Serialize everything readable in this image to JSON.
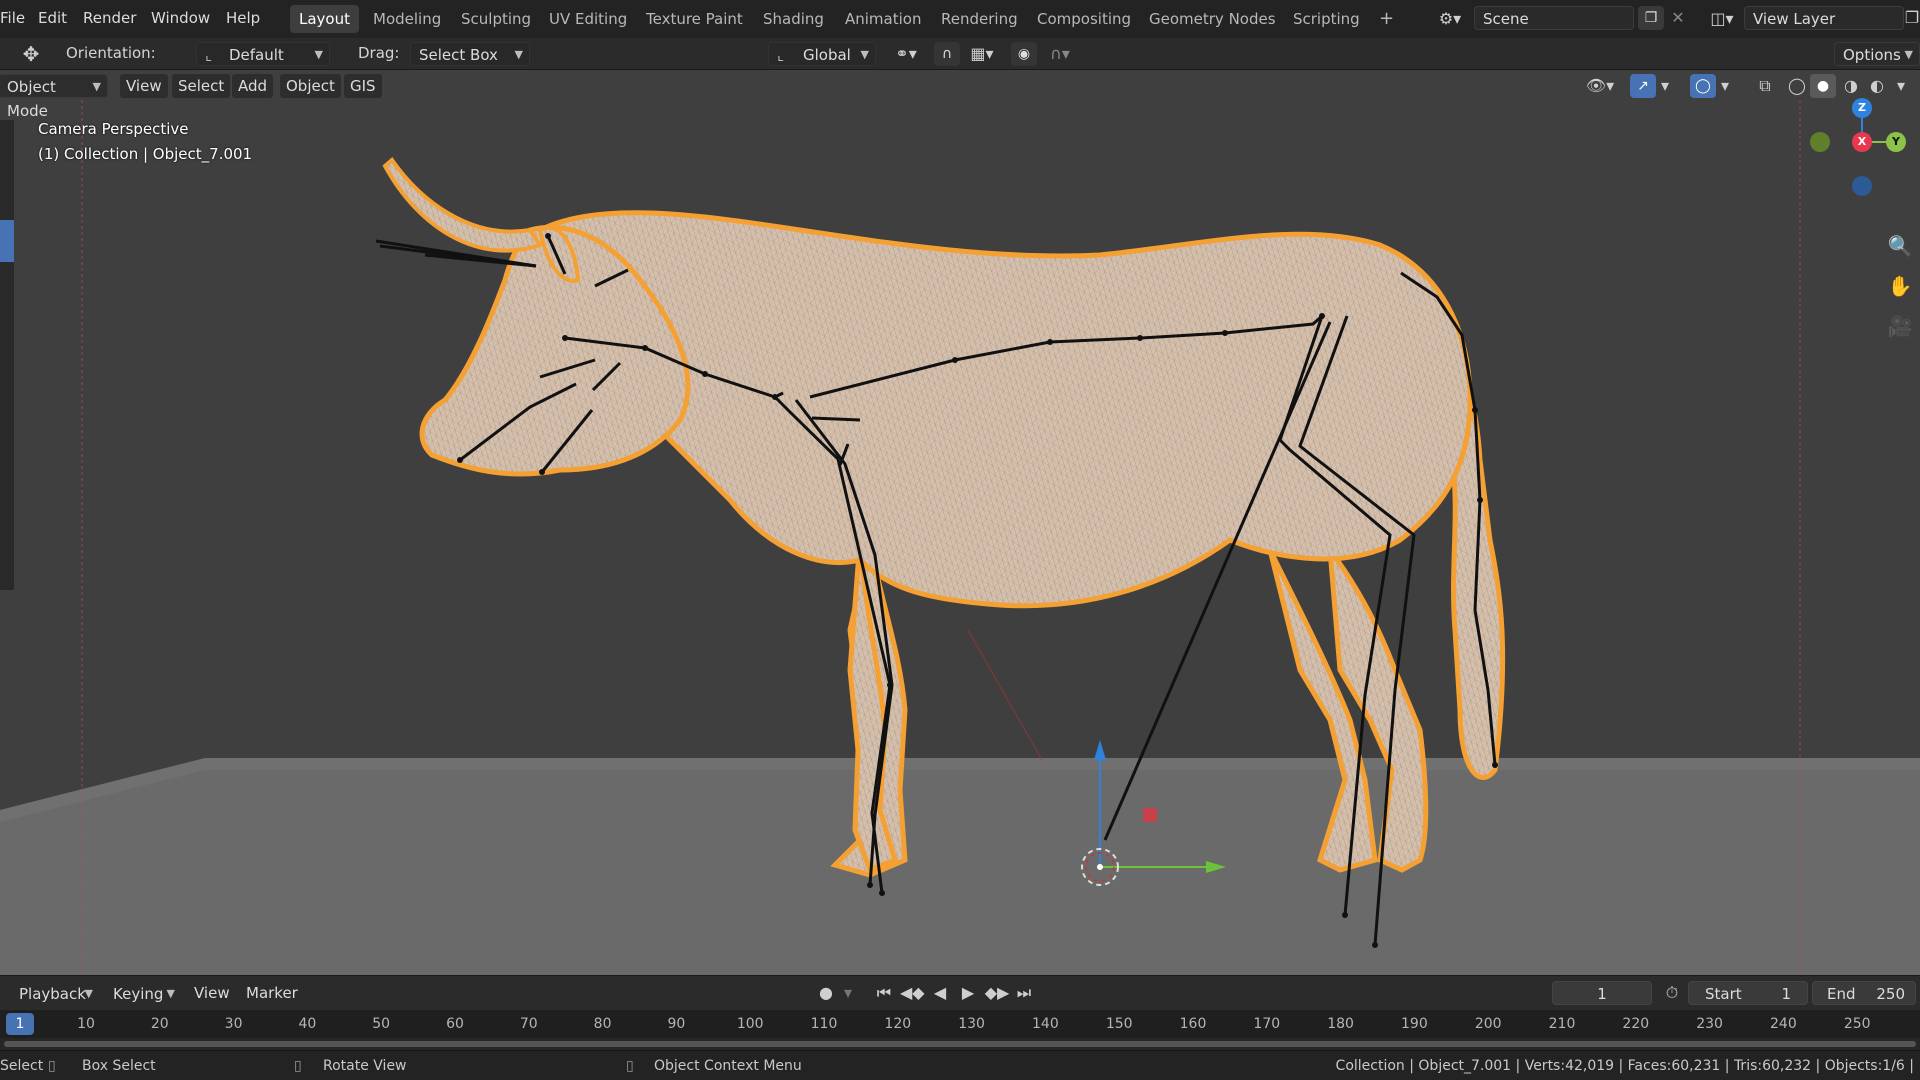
{
  "topbar": {
    "menus": [
      "File",
      "Edit",
      "Render",
      "Window",
      "Help"
    ],
    "workspaces": [
      "Layout",
      "Modeling",
      "Sculpting",
      "UV Editing",
      "Texture Paint",
      "Shading",
      "Animation",
      "Rendering",
      "Compositing",
      "Geometry Nodes",
      "Scripting"
    ],
    "active_workspace": "Layout",
    "add_tab_label": "+",
    "scene_label": "Scene",
    "view_layer_label": "View Layer"
  },
  "toolbar": {
    "orientation_label": "Orientation:",
    "orientation_value": "Default",
    "drag_label": "Drag:",
    "drag_value": "Select Box",
    "transform_space": "Global",
    "options_label": "Options"
  },
  "viewport_header": {
    "mode": "Object Mode",
    "menus": [
      "View",
      "Select",
      "Add",
      "Object",
      "GIS"
    ]
  },
  "viewport": {
    "camera_label": "Camera Perspective",
    "collection_label": "(1) Collection | Object_7.001",
    "gizmo_axes": {
      "z": "Z",
      "x": "X",
      "y": "Y"
    }
  },
  "timeline": {
    "menus": [
      "Playback",
      "Keying",
      "View",
      "Marker"
    ],
    "current_frame": "1",
    "start_label": "Start",
    "start_value": "1",
    "end_label": "End",
    "end_value": "250",
    "ruler_ticks": [
      "10",
      "20",
      "30",
      "40",
      "50",
      "60",
      "70",
      "80",
      "90",
      "100",
      "110",
      "120",
      "130",
      "140",
      "150",
      "160",
      "170",
      "180",
      "190",
      "200",
      "210",
      "220",
      "230",
      "240",
      "250"
    ],
    "current_marker": "1"
  },
  "statusbar": {
    "select_label": "Select",
    "box_select_label": "Box Select",
    "rotate_label": "Rotate View",
    "context_label": "Object Context Menu",
    "stats": "Collection | Object_7.001 | Verts:42,019 | Faces:60,231 | Tris:60,232 | Objects:1/6 |"
  },
  "colors": {
    "accent_blue": "#4772b3",
    "selection_orange": "#f5a033",
    "axis_x": "#e8384f",
    "axis_y": "#8bc34a",
    "axis_z": "#2f83e0"
  }
}
